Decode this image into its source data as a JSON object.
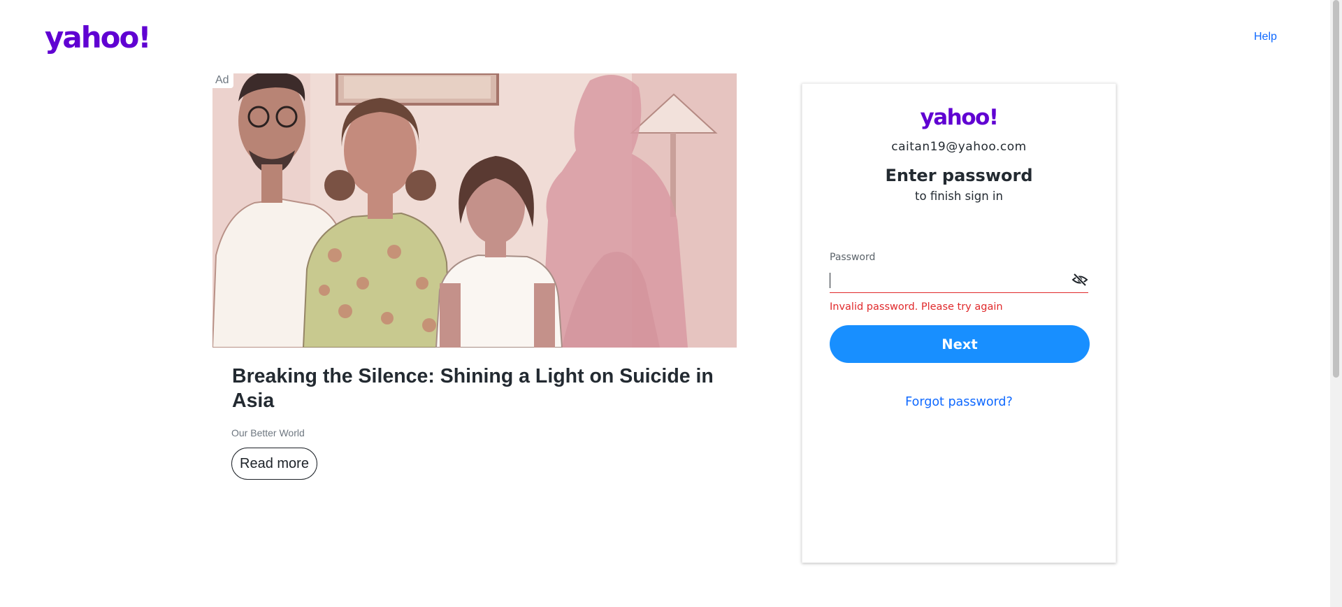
{
  "header": {
    "logo_text": "yahoo!",
    "help_label": "Help"
  },
  "ad": {
    "badge": "Ad",
    "title": "Breaking the Silence: Shining a Light on Suicide in Asia",
    "source": "Our Better World",
    "cta_label": "Read more"
  },
  "login": {
    "logo_text": "yahoo!",
    "email": "caitan19@yahoo.com",
    "heading": "Enter password",
    "subheading": "to finish sign in",
    "password_label": "Password",
    "password_value": "",
    "error": "Invalid password. Please try again",
    "next_label": "Next",
    "forgot_label": "Forgot password?"
  },
  "colors": {
    "brand": "#6001d2",
    "primary_button": "#188fff",
    "link": "#0f69ff",
    "error": "#e0292b"
  },
  "icons": {
    "password_toggle": "eye-slash-icon"
  }
}
